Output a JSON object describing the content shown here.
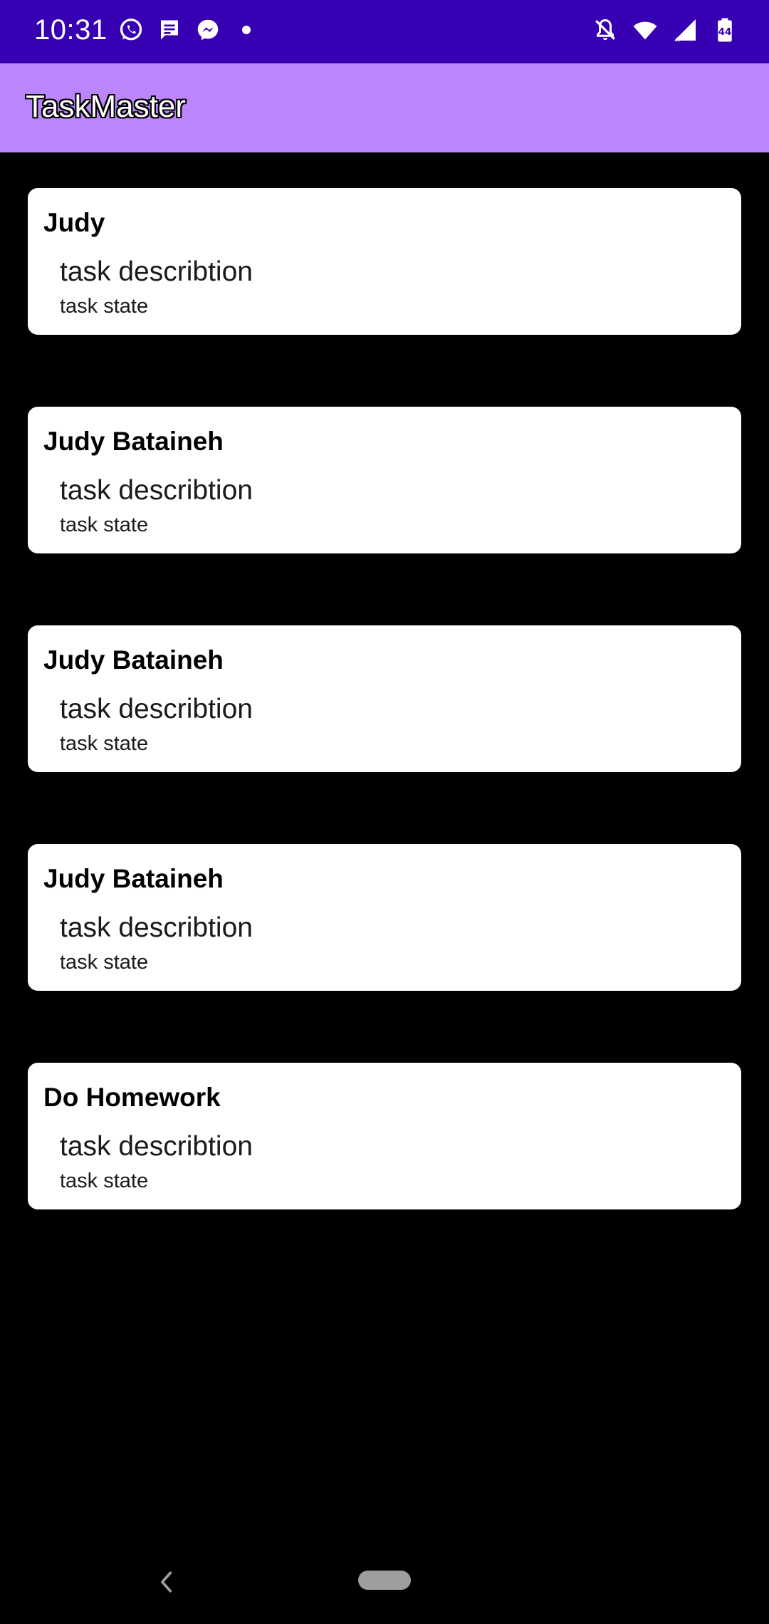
{
  "status_bar": {
    "time": "10:31",
    "left_icons": [
      "whatsapp-icon",
      "message-icon",
      "messenger-icon",
      "dot-icon"
    ],
    "right_icons": [
      "notifications-off-icon",
      "wifi-icon",
      "signal-icon",
      "battery-icon"
    ],
    "battery_level": "44",
    "background": "#3700b3"
  },
  "app_bar": {
    "title": "TaskMaster",
    "background": "#bb86fc"
  },
  "tasks": [
    {
      "title": "Judy",
      "description": "task describtion",
      "state": "task state"
    },
    {
      "title": "Judy Bataineh",
      "description": "task describtion",
      "state": "task state"
    },
    {
      "title": "Judy Bataineh",
      "description": "task describtion",
      "state": "task state"
    },
    {
      "title": "Judy Bataineh",
      "description": "task describtion",
      "state": "task state"
    },
    {
      "title": "Do Homework",
      "description": "task describtion",
      "state": "task state"
    }
  ],
  "nav_bar": {
    "icons": [
      "back-icon",
      "home-pill-icon"
    ]
  }
}
